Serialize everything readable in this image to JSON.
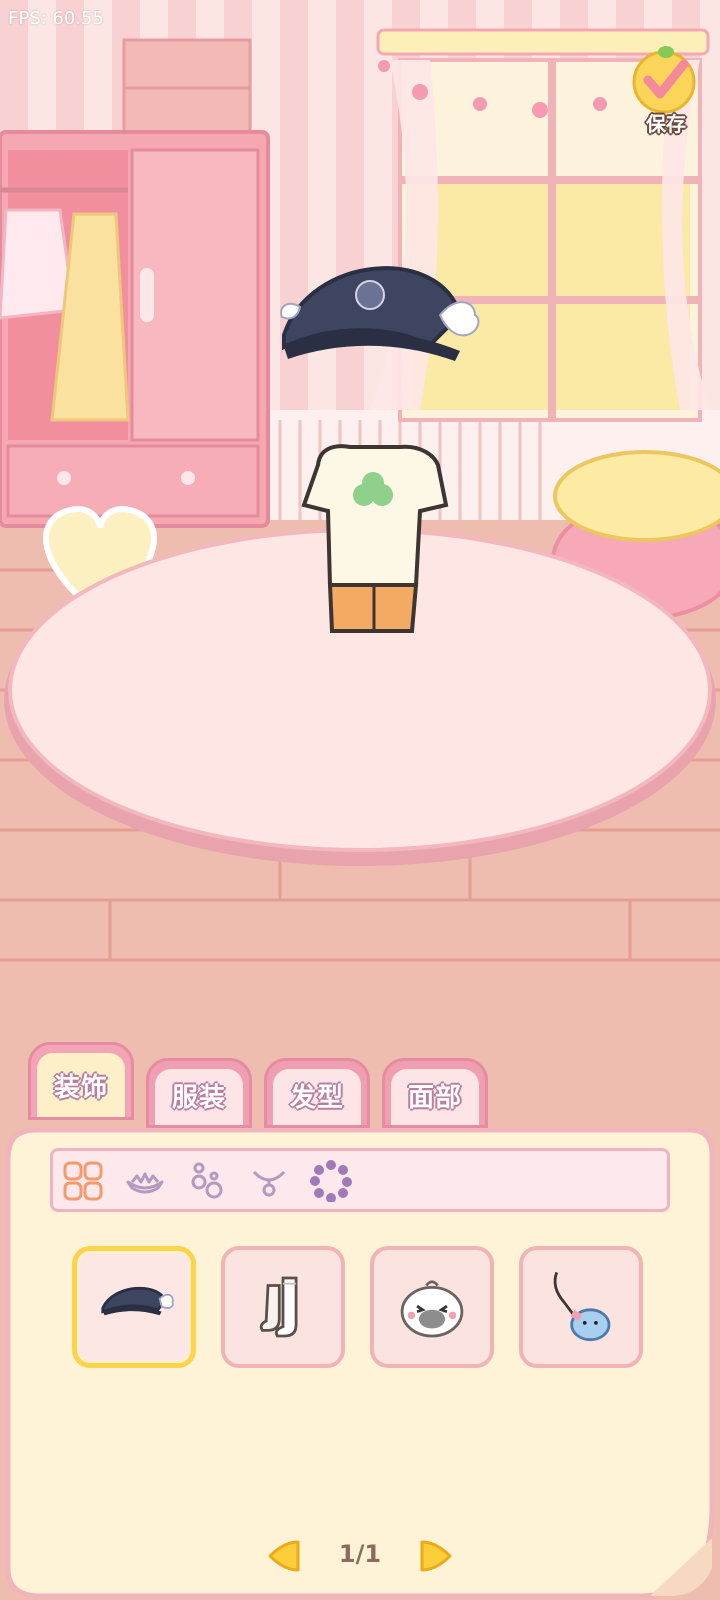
{
  "debug": {
    "fps_text": "FPS: 60.55"
  },
  "toolbar": {
    "save_label": "保存",
    "save_icon": "check-icon"
  },
  "tabs": [
    {
      "label": "装饰",
      "active": true
    },
    {
      "label": "服装",
      "active": false
    },
    {
      "label": "发型",
      "active": false
    },
    {
      "label": "面部",
      "active": false
    }
  ],
  "subcategories": [
    {
      "icon": "grid-all-icon",
      "selected": true
    },
    {
      "icon": "crown-icon",
      "selected": false
    },
    {
      "icon": "earrings-icon",
      "selected": false
    },
    {
      "icon": "necklace-icon",
      "selected": false
    },
    {
      "icon": "wreath-icon",
      "selected": false
    }
  ],
  "items": [
    {
      "icon": "sailor-hat-icon",
      "selected": true
    },
    {
      "icon": "socks-icon",
      "selected": false
    },
    {
      "icon": "bird-plush-icon",
      "selected": false
    },
    {
      "icon": "fish-keychain-icon",
      "selected": false
    }
  ],
  "pager": {
    "page_text": "1/1"
  },
  "colors": {
    "accent_pink": "#f3a4b7",
    "selected_yellow": "#fcd34d",
    "panel_cream": "#fef3d6",
    "tab_text_outline": "#b87fa1"
  }
}
